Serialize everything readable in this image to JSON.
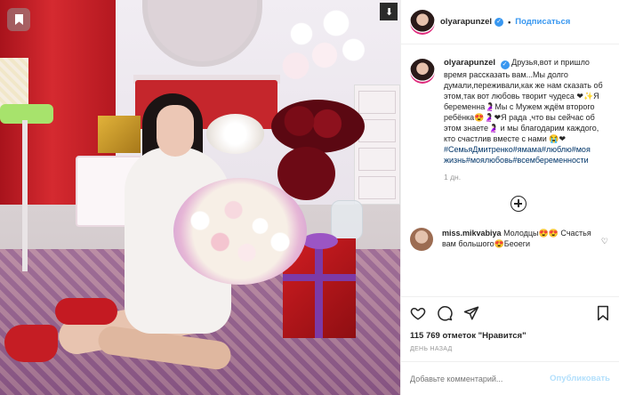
{
  "account": {
    "username": "olyarapunzel",
    "follow_label": "Подписаться",
    "verified_mark": "✓",
    "separator": "•"
  },
  "caption": {
    "username": "olyarapunzel",
    "text": "Друзья,вот и пришло время рассказать вам...Мы долго думали,переживали,как же нам сказать об этом,так вот любовь творит чудеса ❤✨Я беременна🤰🏻Мы с Мужем ждём второго ребёнка😍🤰🏻❤Я рада ,что вы сейчас об этом знаете🤰🏻 и мы благодарим каждого, кто счастлив вместе с нами 😭❤",
    "hashtags": "#СемьяДмитренко#ямама#люблю#моя жизнь#моялюбовь#всембеременности",
    "time_ago": "1 дн."
  },
  "comment": {
    "username": "miss.mikvabiya",
    "text": "Молодцы😍😍 Счастья вам большого😍Беоеги"
  },
  "actions": {
    "like_icon": "heart-icon",
    "comment_icon": "comment-icon",
    "share_icon": "share-icon",
    "bookmark_icon": "bookmark-icon"
  },
  "likes": "115 769 отметок \"Нравится\"",
  "date": "ДЕНЬ НАЗАД",
  "add_comment": {
    "placeholder": "Добавьте комментарий...",
    "publish_label": "Опубликовать"
  },
  "colors": {
    "link_blue": "#3897f0",
    "publish_disabled": "#b2dffc",
    "hashtag": "#003569"
  }
}
